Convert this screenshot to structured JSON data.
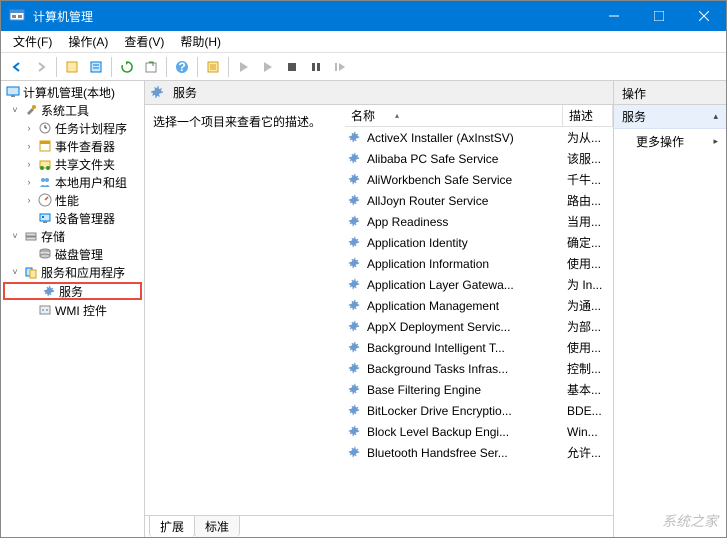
{
  "window": {
    "title": "计算机管理"
  },
  "menu": {
    "file": "文件(F)",
    "action": "操作(A)",
    "view": "查看(V)",
    "help": "帮助(H)"
  },
  "tree": {
    "root": "计算机管理(本地)",
    "system_tools": "系统工具",
    "task_scheduler": "任务计划程序",
    "event_viewer": "事件查看器",
    "shared_folders": "共享文件夹",
    "local_users": "本地用户和组",
    "performance": "性能",
    "device_manager": "设备管理器",
    "storage": "存储",
    "disk_management": "磁盘管理",
    "services_apps": "服务和应用程序",
    "services": "服务",
    "wmi": "WMI 控件"
  },
  "mid": {
    "title": "服务",
    "prompt": "选择一个项目来查看它的描述。",
    "col_name": "名称",
    "col_desc": "描述",
    "tab_extended": "扩展",
    "tab_standard": "标准"
  },
  "services_list": [
    {
      "name": "ActiveX Installer (AxInstSV)",
      "desc": "为从..."
    },
    {
      "name": "Alibaba PC Safe Service",
      "desc": "该服..."
    },
    {
      "name": "AliWorkbench Safe Service",
      "desc": "千牛..."
    },
    {
      "name": "AllJoyn Router Service",
      "desc": "路由..."
    },
    {
      "name": "App Readiness",
      "desc": "当用..."
    },
    {
      "name": "Application Identity",
      "desc": "确定..."
    },
    {
      "name": "Application Information",
      "desc": "使用..."
    },
    {
      "name": "Application Layer Gatewa...",
      "desc": "为 In..."
    },
    {
      "name": "Application Management",
      "desc": "为通..."
    },
    {
      "name": "AppX Deployment Servic...",
      "desc": "为部..."
    },
    {
      "name": "Background Intelligent T...",
      "desc": "使用..."
    },
    {
      "name": "Background Tasks Infras...",
      "desc": "控制..."
    },
    {
      "name": "Base Filtering Engine",
      "desc": "基本..."
    },
    {
      "name": "BitLocker Drive Encryptio...",
      "desc": "BDE..."
    },
    {
      "name": "Block Level Backup Engi...",
      "desc": "Win..."
    },
    {
      "name": "Bluetooth Handsfree Ser...",
      "desc": "允许..."
    }
  ],
  "actions": {
    "header": "操作",
    "section": "服务",
    "more": "更多操作"
  },
  "watermark": "系统之家"
}
